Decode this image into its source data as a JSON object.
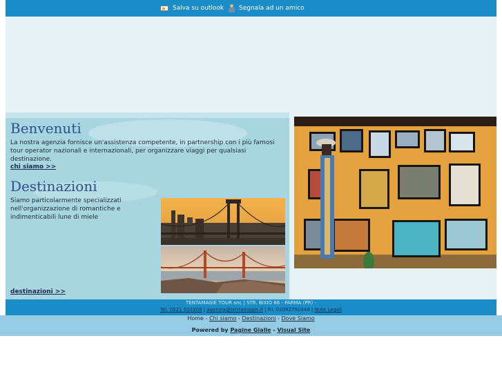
{
  "topbar": {
    "outlook_label": "Salva su outlook",
    "friend_label": "Segnala ad un amico",
    "outlook_icon": "mail-icon",
    "friend_icon": "person-icon"
  },
  "benvenuti": {
    "title": "Benvenuti",
    "text": "La nostra agenzia fornisce un'assistenza competente, in partnership con i più famosi tour operator nazionali e internazionali, per organizzare viaggi per qualsiasi destinazione.",
    "link": "chi siamo >>"
  },
  "destinazioni": {
    "title": "Destinazioni",
    "text": "Siamo particolarmente specializzati nell'organizzazione di romantiche e indimenticabili lune di miele",
    "link": "destinazioni >>"
  },
  "footer": {
    "company": "TENTAMAGIE TOUR snc | STR. BIXIO 66 - PARMA (PR) -",
    "phone": "Tel. 0521 503309",
    "email": "agenzia@tentamagie.it",
    "piva": "P.I. 02092750344",
    "legal": "Note Legali",
    "sep": "|"
  },
  "nav": {
    "home": "Home",
    "chi_siamo": "Chi siamo",
    "destinazioni": "Destinazioni",
    "dove_siamo": "Dove Siamo",
    "sep": "-"
  },
  "powered": {
    "prefix": "Powered by",
    "pagine_gialle": "Pagine Gialle",
    "sep": "-",
    "visual_site": "Visual Site"
  },
  "colors": {
    "topbar": "#1a8cc7",
    "panel": "#a8d6e0",
    "heading": "#2e4f8a",
    "nav": "#96cbe4"
  }
}
